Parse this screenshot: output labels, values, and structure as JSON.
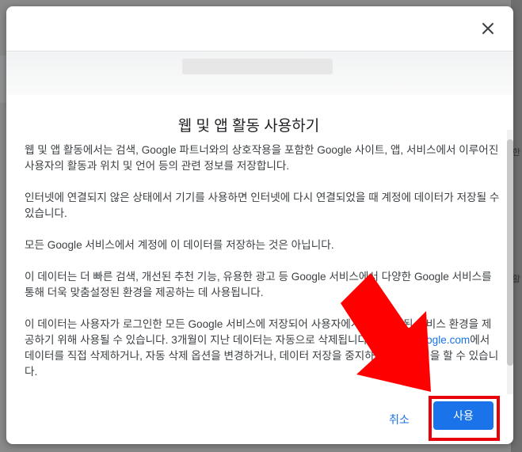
{
  "dialog": {
    "title": "웹 및 앱 활동 사용하기",
    "paragraphs": [
      "웹 및 앱 활동에서는 검색, Google 파트너와의 상호작용을 포함한 Google 사이트, 앱, 서비스에서 이루어진 사용자의 활동과 위치 및 언어 등의 관련 정보를 저장합니다.",
      "인터넷에 연결되지 않은 상태에서 기기를 사용하면 인터넷에 다시 연결되었을 때 계정에 데이터가 저장될 수 있습니다.",
      "모든 Google 서비스에서 계정에 이 데이터를 저장하는 것은 아닙니다.",
      "이 데이터는 더 빠른 검색, 개선된 추천 기능, 유용한 광고 등 Google 서비스에서 다양한 Google 서비스를 통해 더욱 맞춤설정된 환경을 제공하는 데 사용됩니다.",
      "이 데이터는 사용자가 로그인한 모든 Google 서비스에 저장되어 사용자에게 맞춤설정된 서비스 환경을 제공하기 위해 사용될 수 있습니다. 3개월이 지난 데이터는 자동으로 삭제됩니다."
    ],
    "last_paragraph": {
      "link": "account.google.com",
      "rest": "에서 데이터를 직접 삭제하거나, 자동 삭제 옵션을 변경하거나, 데이터 저장을 중지하는 등의 작업을 할 수 있습니다."
    },
    "cancel_label": "취소",
    "confirm_label": "사용",
    "close_icon": "close-icon"
  },
  "backdrop": {
    "glyph_1": "한",
    "glyph_2": "활"
  },
  "colors": {
    "accent": "#1a73e8",
    "highlight": "#e8000b",
    "arrow": "#ff0000"
  }
}
